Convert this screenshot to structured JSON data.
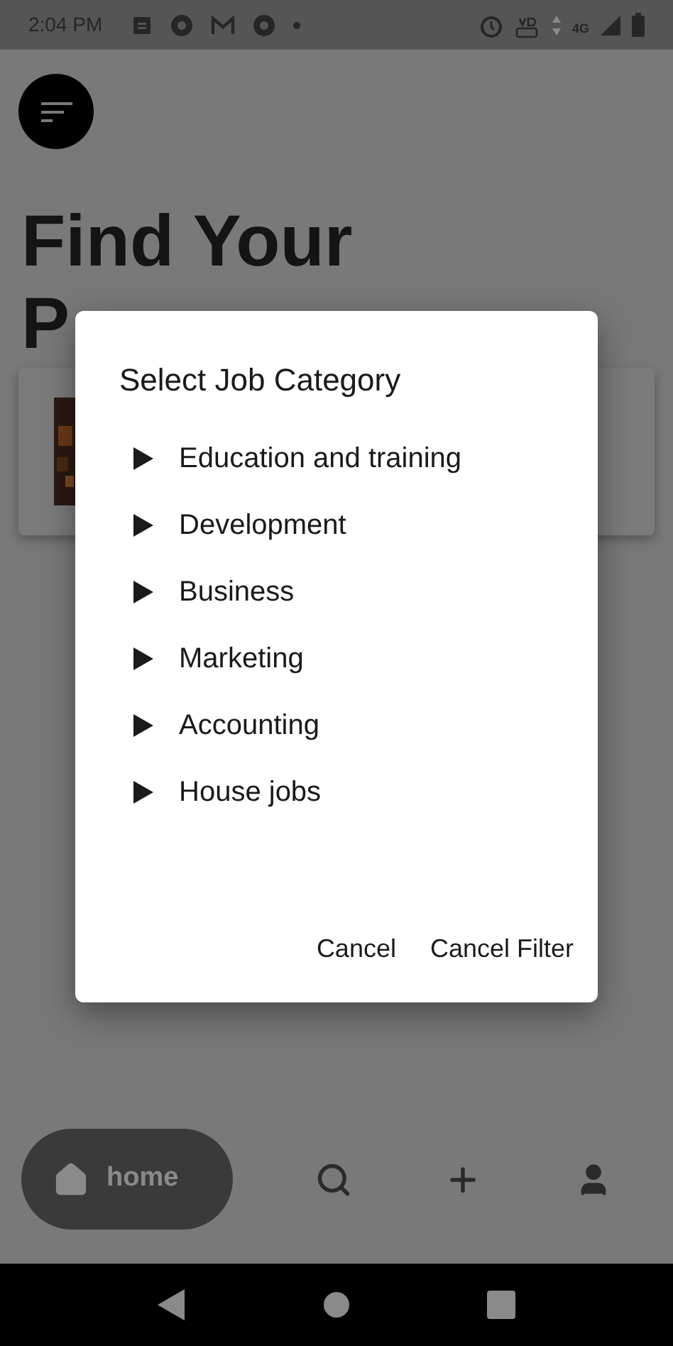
{
  "status_bar": {
    "time": "2:04 PM",
    "network": "4G"
  },
  "page": {
    "title_lines": [
      "Find Your",
      "P"
    ]
  },
  "dialog": {
    "title": "Select Job Category",
    "categories": [
      {
        "label": "Education and training"
      },
      {
        "label": "Development"
      },
      {
        "label": "Business"
      },
      {
        "label": "Marketing"
      },
      {
        "label": "Accounting"
      },
      {
        "label": "House jobs"
      }
    ],
    "buttons": [
      "Cancel",
      "Cancel Filter"
    ]
  },
  "bottom_nav": [
    {
      "kind": "home",
      "label": "home",
      "selected": true
    },
    {
      "kind": "search",
      "selected": false
    },
    {
      "kind": "add",
      "selected": false
    },
    {
      "kind": "profile",
      "selected": false
    }
  ]
}
